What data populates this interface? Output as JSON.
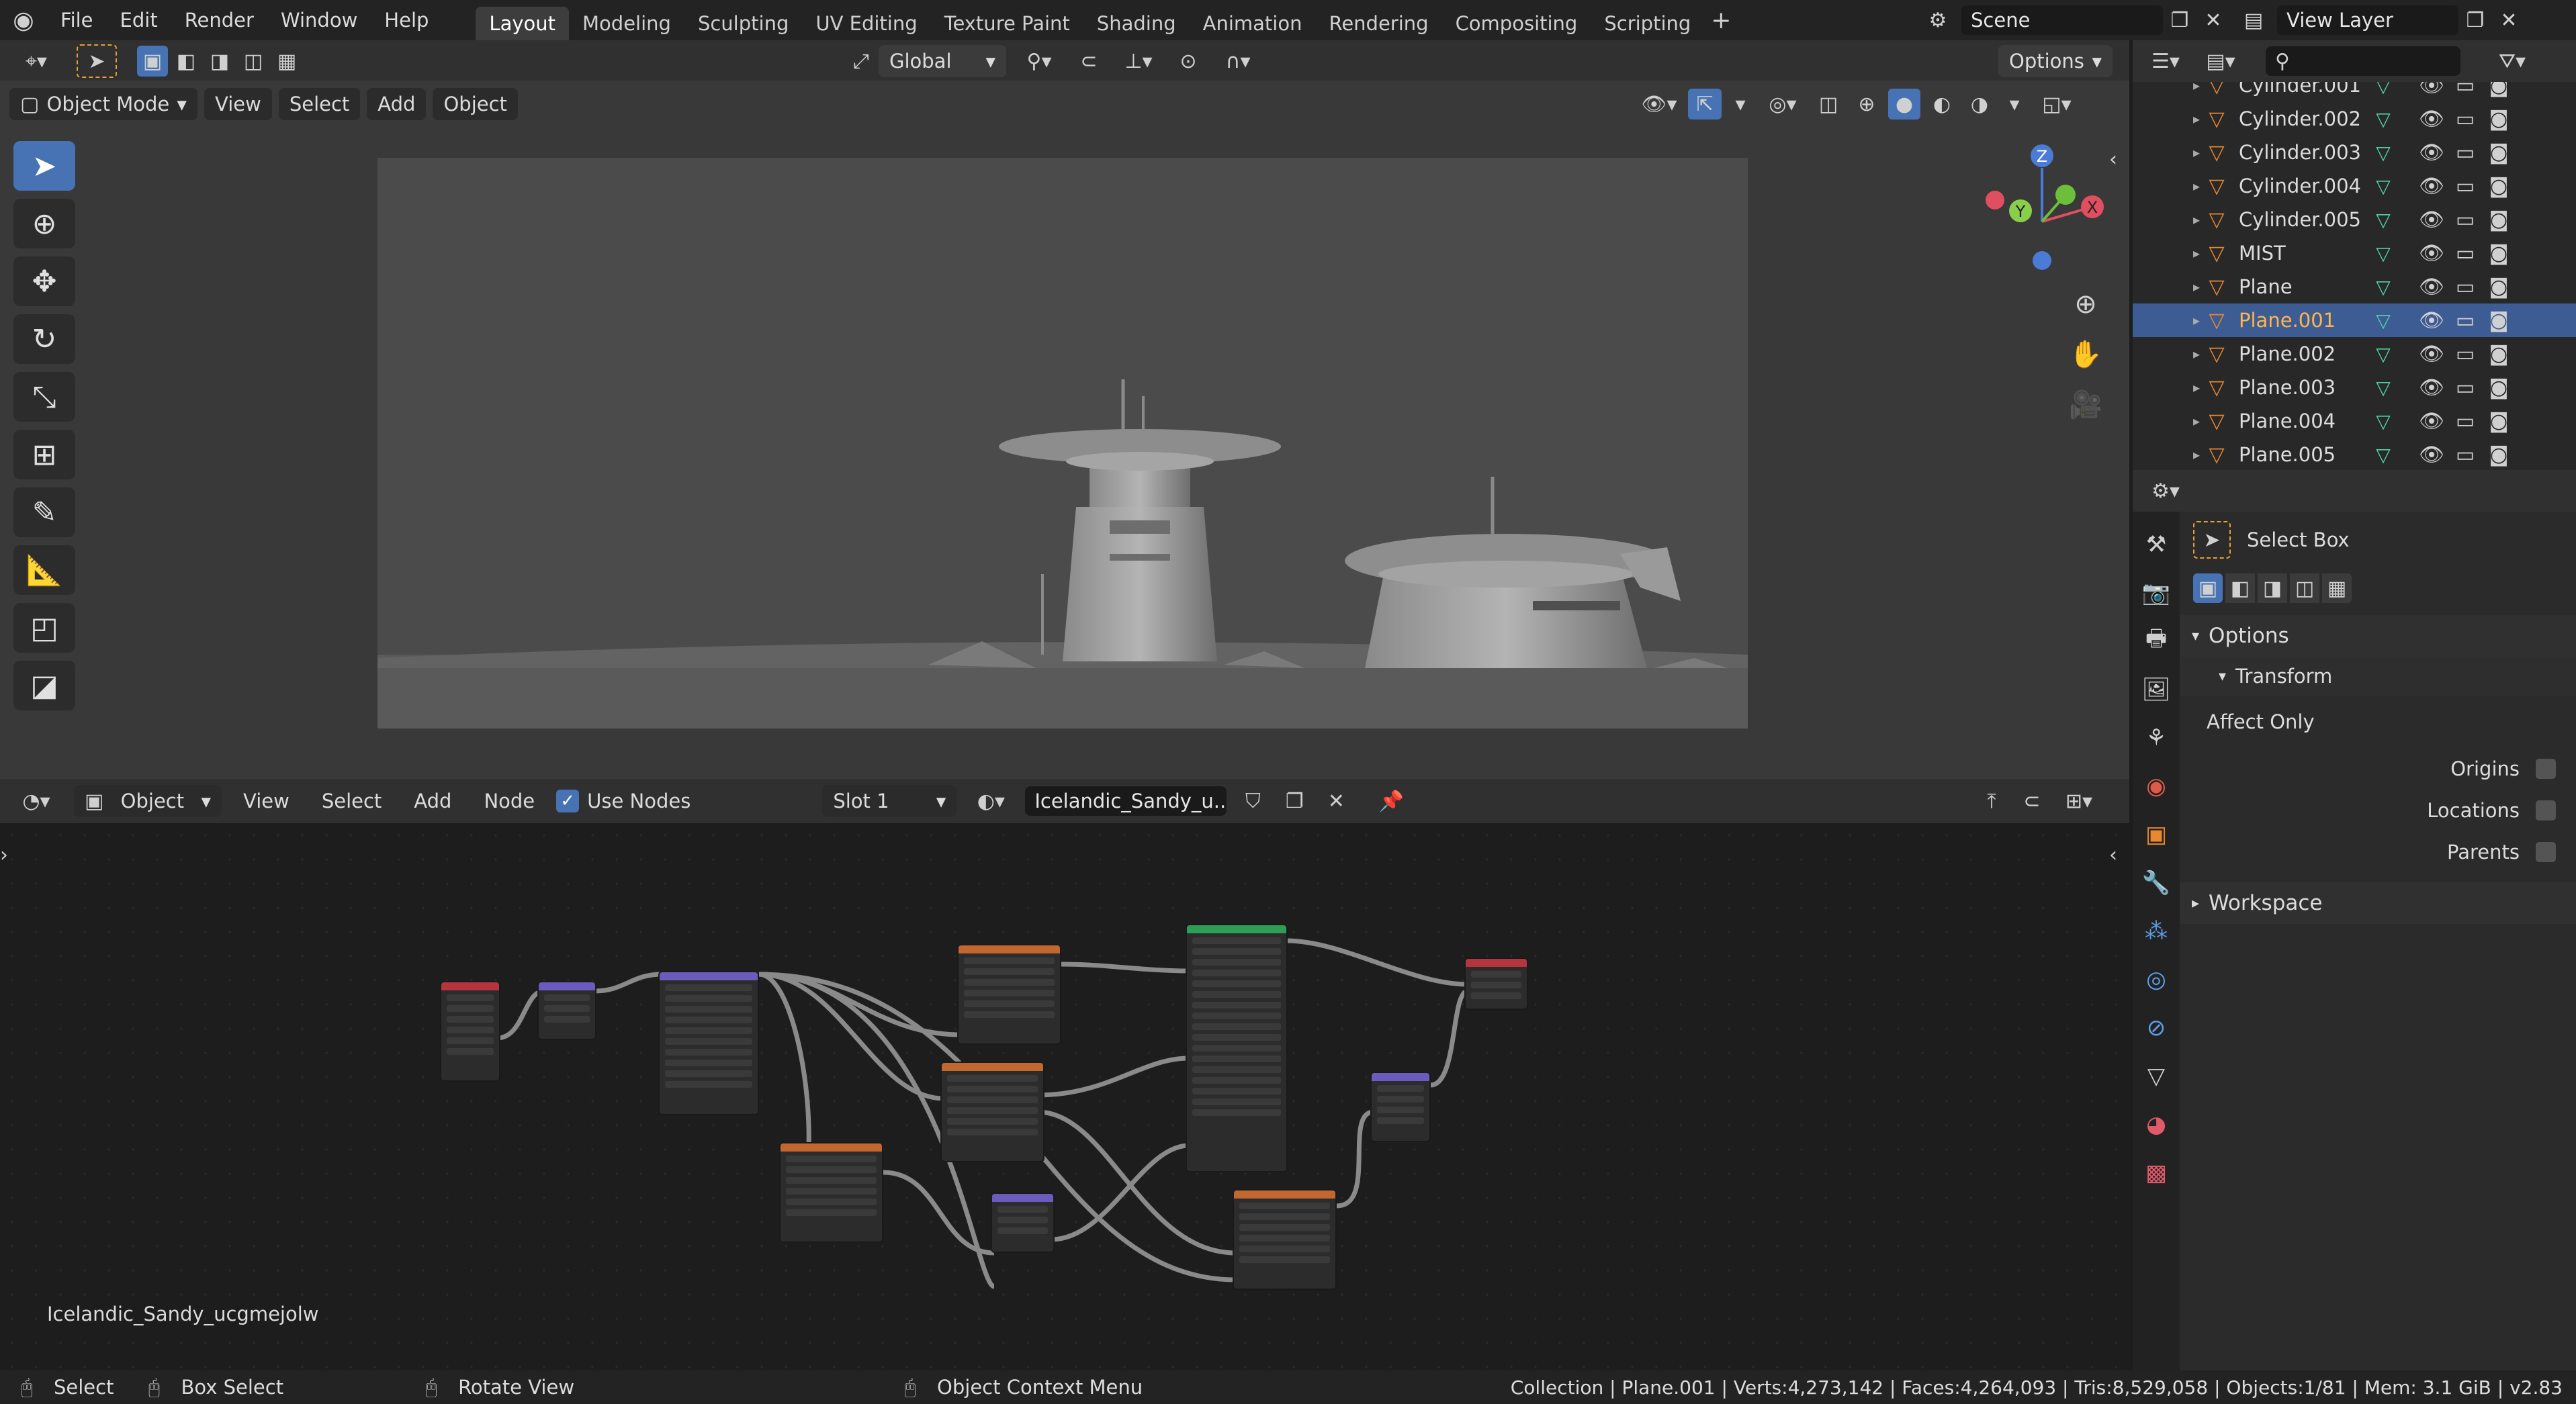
{
  "topbar": {
    "menus": [
      "File",
      "Edit",
      "Render",
      "Window",
      "Help"
    ],
    "workspaces": [
      "Layout",
      "Modeling",
      "Sculpting",
      "UV Editing",
      "Texture Paint",
      "Shading",
      "Animation",
      "Rendering",
      "Compositing",
      "Scripting"
    ],
    "active_workspace": "Layout",
    "scene": "Scene",
    "view_layer": "View Layer"
  },
  "viewport_toolbar": {
    "orientation": "Global",
    "options_label": "Options"
  },
  "viewport_header": {
    "mode": "Object Mode",
    "menus": [
      "View",
      "Select",
      "Add",
      "Object"
    ]
  },
  "gizmo": {
    "z": "Z",
    "y": "Y",
    "x": "X"
  },
  "node_header": {
    "object_type": "Object",
    "menus": [
      "View",
      "Select",
      "Add",
      "Node"
    ],
    "use_nodes_label": "Use Nodes",
    "slot": "Slot 1",
    "material": "Icelandic_Sandy_u.."
  },
  "node_editor": {
    "material_name": "Icelandic_Sandy_ucgmejolw"
  },
  "outliner": {
    "rows": [
      {
        "name": "Cylinder.001",
        "selected": false
      },
      {
        "name": "Cylinder.002",
        "selected": false
      },
      {
        "name": "Cylinder.003",
        "selected": false
      },
      {
        "name": "Cylinder.004",
        "selected": false
      },
      {
        "name": "Cylinder.005",
        "selected": false
      },
      {
        "name": "MIST",
        "selected": false
      },
      {
        "name": "Plane",
        "selected": false
      },
      {
        "name": "Plane.001",
        "selected": true
      },
      {
        "name": "Plane.002",
        "selected": false
      },
      {
        "name": "Plane.003",
        "selected": false
      },
      {
        "name": "Plane.004",
        "selected": false
      },
      {
        "name": "Plane.005",
        "selected": false
      }
    ]
  },
  "properties": {
    "tool_name": "Select Box",
    "options_label": "Options",
    "transform_label": "Transform",
    "affect_only_label": "Affect Only",
    "origins_label": "Origins",
    "locations_label": "Locations",
    "parents_label": "Parents",
    "workspace_label": "Workspace"
  },
  "statusbar": {
    "select": "Select",
    "box_select": "Box Select",
    "rotate_view": "Rotate View",
    "context_menu": "Object Context Menu",
    "stats": "Collection | Plane.001 | Verts:4,273,142 | Faces:4,264,093 | Tris:8,529,058 | Objects:1/81 | Mem: 3.1 GiB | v2.83"
  },
  "colors": {
    "accent": "#4772b3",
    "selected_row": "#3e5c94",
    "selected_text": "#ffb54a",
    "object_icon": "#e8882f",
    "mesh_icon": "#4fd1a0"
  }
}
